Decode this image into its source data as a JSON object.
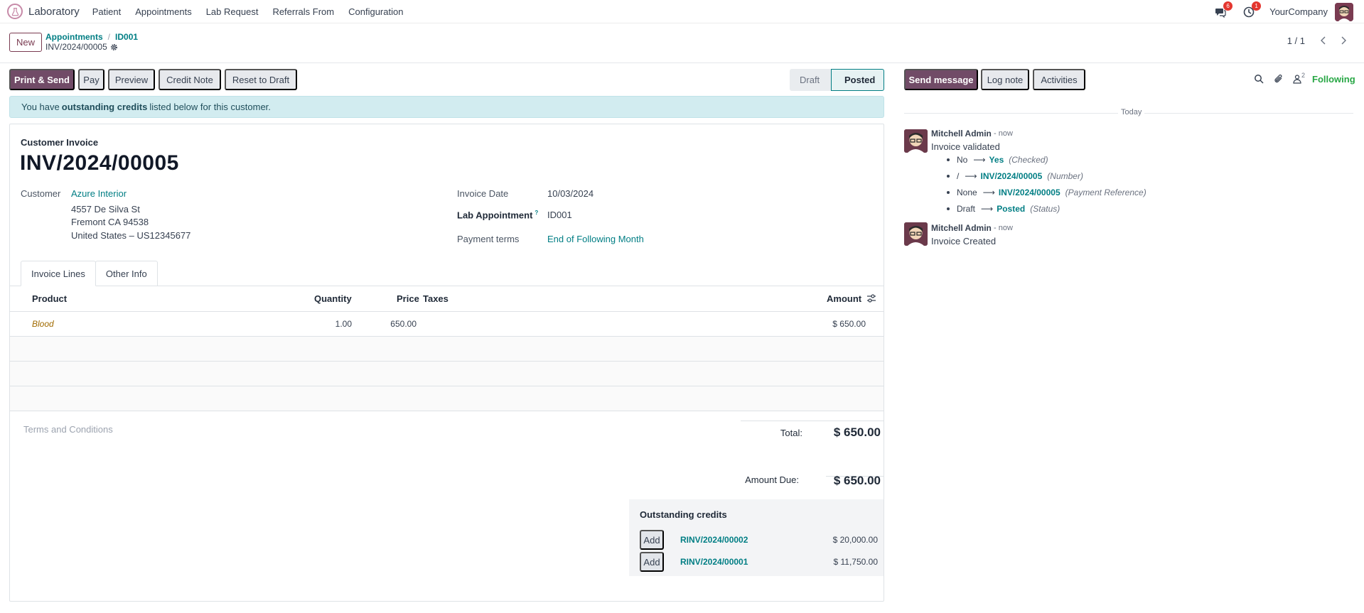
{
  "navbar": {
    "app_name": "Laboratory",
    "menu": [
      "Patient",
      "Appointments",
      "Lab Request",
      "Referrals From",
      "Configuration"
    ],
    "messages_badge": "6",
    "activities_badge": "1",
    "company": "YourCompany"
  },
  "control": {
    "new_label": "New",
    "breadcrumb": [
      "Appointments",
      "ID001"
    ],
    "record_name": "INV/2024/00005",
    "pager": "1 / 1"
  },
  "buttons": {
    "print_send": "Print & Send",
    "pay": "Pay",
    "preview": "Preview",
    "credit_note": "Credit Note",
    "reset_draft": "Reset to Draft"
  },
  "status": {
    "draft": "Draft",
    "posted": "Posted"
  },
  "alert": {
    "pre": "You have",
    "bold": "outstanding credits",
    "post": "listed below for this customer."
  },
  "invoice": {
    "type": "Customer Invoice",
    "number": "INV/2024/00005",
    "customer_label": "Customer",
    "customer_name": "Azure Interior",
    "address": [
      "4557 De Silva St",
      "Fremont CA 94538",
      "United States – US12345677"
    ],
    "invoice_date_label": "Invoice Date",
    "invoice_date": "10/03/2024",
    "lab_appointment_label": "Lab Appointment",
    "lab_appointment_help": "?",
    "lab_appointment": "ID001",
    "payment_terms_label": "Payment terms",
    "payment_terms": "End of Following Month"
  },
  "tabs": [
    "Invoice Lines",
    "Other Info"
  ],
  "lines": {
    "columns": {
      "product": "Product",
      "quantity": "Quantity",
      "price": "Price",
      "taxes": "Taxes",
      "amount": "Amount"
    },
    "rows": [
      {
        "product": "Blood",
        "quantity": "1.00",
        "price": "650.00",
        "taxes": "",
        "amount": "$ 650.00"
      }
    ]
  },
  "terms_placeholder": "Terms and Conditions",
  "totals": {
    "total_label": "Total:",
    "total": "$ 650.00",
    "due_label": "Amount Due:",
    "due": "$ 650.00"
  },
  "credits": {
    "title": "Outstanding credits",
    "add_label": "Add",
    "rows": [
      {
        "ref": "RINV/2024/00002",
        "amount": "$ 20,000.00"
      },
      {
        "ref": "RINV/2024/00001",
        "amount": "$ 11,750.00"
      }
    ]
  },
  "chatter": {
    "send_message": "Send message",
    "log_note": "Log note",
    "activities": "Activities",
    "followers_count": "2",
    "following": "Following",
    "today": "Today",
    "messages": [
      {
        "author": "Mitchell Admin",
        "time": "- now",
        "body": "Invoice validated",
        "tracking": [
          {
            "old": "No",
            "new": "Yes",
            "field": "(Checked)"
          },
          {
            "old": "/",
            "new": "INV/2024/00005",
            "field": "(Number)"
          },
          {
            "old": "None",
            "new": "INV/2024/00005",
            "field": "(Payment Reference)"
          },
          {
            "old": "Draft",
            "new": "Posted",
            "field": "(Status)"
          }
        ]
      },
      {
        "author": "Mitchell Admin",
        "time": "- now",
        "body": "Invoice Created"
      }
    ]
  },
  "colors": {
    "brand": "#714b67",
    "link": "#017e84",
    "alert_bg": "#d2ecf0",
    "following": "#28a745",
    "badge": "#e4362f"
  }
}
